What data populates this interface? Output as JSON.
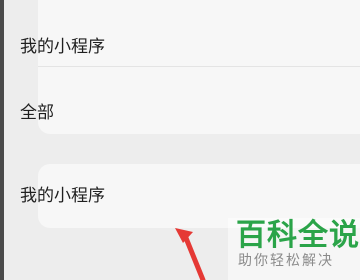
{
  "menu": {
    "items": [
      {
        "label": "我的小程序"
      },
      {
        "label": "全部"
      },
      {
        "label": "我的小程序"
      }
    ]
  },
  "watermark": {
    "logo": "百科全说",
    "subtitle": "助你轻松解决"
  },
  "annotation": {
    "arrow_color": "#e53935"
  }
}
